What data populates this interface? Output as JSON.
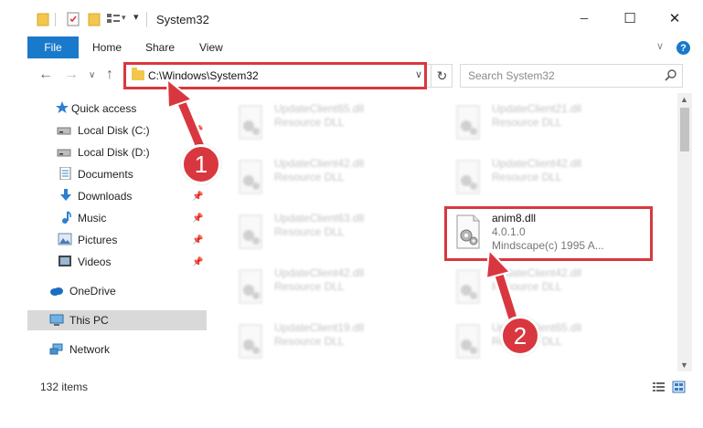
{
  "window": {
    "title": "System32",
    "controls": {
      "minimize": "─",
      "maximize": "☐",
      "close": "✕"
    }
  },
  "ribbon": {
    "tabs": [
      "File",
      "Home",
      "Share",
      "View"
    ],
    "expand_chevron": "∨",
    "help": "?"
  },
  "address_bar": {
    "path": "C:\\Windows\\System32",
    "dropdown": "∨",
    "refresh": "↻"
  },
  "search": {
    "placeholder": "Search System32"
  },
  "nav": {
    "back": "←",
    "forward": "→",
    "history": "∨",
    "up": "↑"
  },
  "sidebar": {
    "items": [
      {
        "label": "Quick access",
        "icon": "star-icon",
        "pinned": false
      },
      {
        "label": "Local Disk (C:)",
        "icon": "drive-icon",
        "pinned": true
      },
      {
        "label": "Local Disk (D:)",
        "icon": "drive-icon",
        "pinned": false
      },
      {
        "label": "Documents",
        "icon": "documents-icon",
        "pinned": true
      },
      {
        "label": "Downloads",
        "icon": "downloads-icon",
        "pinned": true
      },
      {
        "label": "Music",
        "icon": "music-icon",
        "pinned": true
      },
      {
        "label": "Pictures",
        "icon": "pictures-icon",
        "pinned": true
      },
      {
        "label": "Videos",
        "icon": "videos-icon",
        "pinned": true
      },
      {
        "label": "OneDrive",
        "icon": "onedrive-icon",
        "pinned": false
      },
      {
        "label": "This PC",
        "icon": "this-pc-icon",
        "pinned": false,
        "selected": true
      },
      {
        "label": "Network",
        "icon": "network-icon",
        "pinned": false
      }
    ]
  },
  "files": {
    "left_column": [
      {
        "name": "UpdateClient65.dll",
        "desc": "Resource DLL"
      },
      {
        "name": "UpdateClient42.dll",
        "desc": "Resource DLL"
      },
      {
        "name": "UpdateClient63.dll",
        "desc": "Resource DLL"
      },
      {
        "name": "UpdateClient42.dll",
        "desc": "Resource DLL"
      },
      {
        "name": "UpdateClient19.dll",
        "desc": "Resource DLL"
      }
    ],
    "right_column": [
      {
        "name": "UpdateClient21.dll",
        "desc": "Resource DLL"
      },
      {
        "name": "UpdateClient42.dll",
        "desc": "Resource DLL"
      },
      {
        "name": "UpdateClient42.dll",
        "desc": "Resource DLL"
      },
      {
        "name": "UpdateClient65.dll",
        "desc": "Resource DLL"
      }
    ],
    "highlighted": {
      "name": "anim8.dll",
      "version": "4.0.1.0",
      "company": "Mindscape(c) 1995 A..."
    }
  },
  "status": {
    "count": "132 items"
  },
  "annotations": {
    "step1": "1",
    "step2": "2",
    "color": "#d9373f"
  }
}
